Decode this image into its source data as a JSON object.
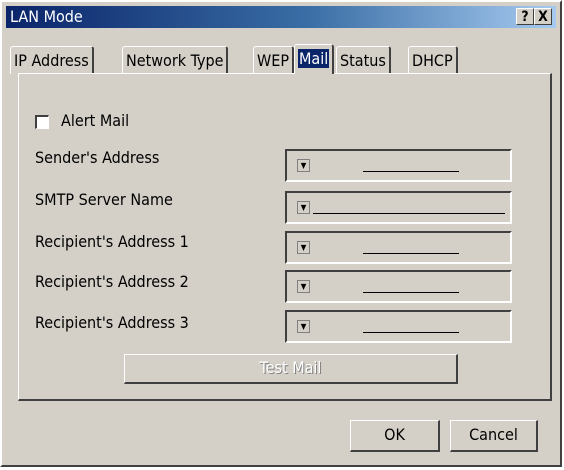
{
  "window": {
    "title": "LAN Mode",
    "help_label": "?",
    "close_label": "X"
  },
  "tabs": [
    {
      "label": "IP Address"
    },
    {
      "label": "Network Type"
    },
    {
      "label": "WEP"
    },
    {
      "label": "Mail",
      "active": true
    },
    {
      "label": "Status"
    },
    {
      "label": "DHCP"
    }
  ],
  "mail": {
    "alert_mail_label": "Alert Mail",
    "alert_mail_checked": false,
    "fields": [
      {
        "label": "Sender's Address",
        "value": ""
      },
      {
        "label": "SMTP Server Name",
        "value": ""
      },
      {
        "label": "Recipient's Address 1",
        "value": ""
      },
      {
        "label": "Recipient's Address 2",
        "value": ""
      },
      {
        "label": "Recipient's Address 3",
        "value": ""
      }
    ],
    "test_mail_label": "Test Mail"
  },
  "buttons": {
    "ok_label": "OK",
    "cancel_label": "Cancel"
  },
  "colors": {
    "dialog": "#d4d0c8",
    "title_start": "#0a246a",
    "title_end": "#a6caf0"
  }
}
